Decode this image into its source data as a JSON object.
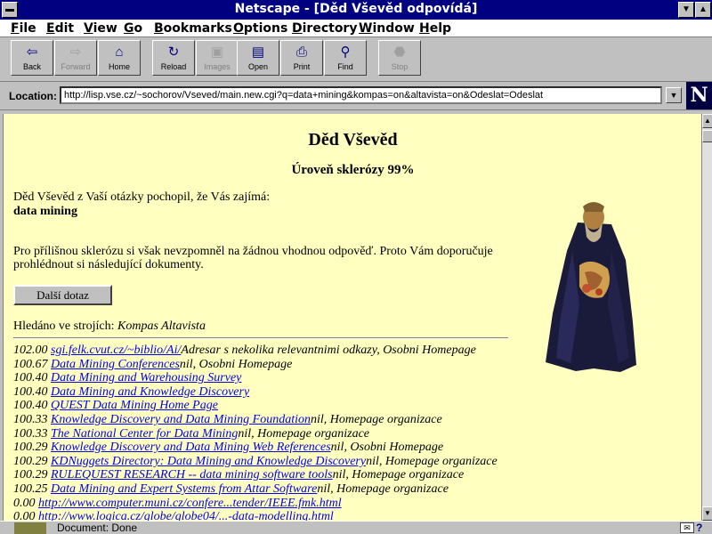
{
  "window": {
    "title": "Netscape - [Děd Vševěd odpovídá]"
  },
  "menu": [
    {
      "label": "File",
      "underline": "F",
      "rest": "ile"
    },
    {
      "label": "Edit",
      "underline": "E",
      "rest": "dit"
    },
    {
      "label": "View",
      "underline": "V",
      "rest": "iew"
    },
    {
      "label": "Go",
      "underline": "G",
      "rest": "o"
    },
    {
      "label": "Bookmarks",
      "underline": "B",
      "rest": "ookmarks"
    },
    {
      "label": "Options",
      "underline": "O",
      "rest": "ptions"
    },
    {
      "label": "Directory",
      "underline": "D",
      "rest": "irectory"
    },
    {
      "label": "Window",
      "underline": "W",
      "rest": "indow"
    },
    {
      "label": "Help",
      "underline": "H",
      "rest": "elp"
    }
  ],
  "toolbar": {
    "back": "Back",
    "forward": "Forward",
    "home": "Home",
    "reload": "Reload",
    "images": "Images",
    "open": "Open",
    "print": "Print",
    "find": "Find",
    "stop": "Stop"
  },
  "location": {
    "label": "Location:",
    "url": "http://lisp.vse.cz/~sochorov/Vseved/main.new.cgi?q=data+mining&kompas=on&altavista=on&Odeslat=Odeslat"
  },
  "page": {
    "title": "Děd Vševěd",
    "subtitle": "Úroveň sklerózy 99%",
    "intro": "Děd Vševěd z Vaší otázky pochopil, že Vás zajímá:",
    "query": "data mining",
    "message1": "Pro přílišnou sklerózu si však nevzpomněl na žádnou vhodnou odpověď. Proto Vám doporučuje",
    "message2": "prohlédnout si následující dokumenty.",
    "button": "Další dotaz",
    "searched_label": "Hledáno ve strojích:",
    "searched_engines": "Kompas Altavista"
  },
  "results": [
    {
      "score": "102.00",
      "link": "sgi.felk.cvut.cz/~biblio/Ai/",
      "desc": "Adresar s nekolika relevantnimi odkazy, Osobni Homepage"
    },
    {
      "score": "100.67",
      "link": "Data Mining Conferences",
      "desc": "nil, Osobni Homepage"
    },
    {
      "score": "100.40",
      "link": "Data Mining and Warehousing Survey",
      "desc": ""
    },
    {
      "score": "100.40",
      "link": "Data Mining and Knowledge Discovery",
      "desc": ""
    },
    {
      "score": "100.40",
      "link": "QUEST Data Mining Home Page",
      "desc": ""
    },
    {
      "score": "100.33",
      "link": "Knowledge Discovery and Data Mining Foundation",
      "desc": "nil, Homepage organizace"
    },
    {
      "score": "100.33",
      "link": "The National Center for Data Mining",
      "desc": "nil, Homepage organizace"
    },
    {
      "score": "100.29",
      "link": "Knowledge Discovery and Data Mining Web References",
      "desc": "nil, Osobni Homepage"
    },
    {
      "score": "100.29",
      "link": "KDNuggets Directory: Data Mining and Knowledge Discovery",
      "desc": "nil, Homepage organizace"
    },
    {
      "score": "100.29",
      "link": "RULEQUEST RESEARCH -- data mining software tools",
      "desc": "nil, Homepage organizace"
    },
    {
      "score": "100.25",
      "link": "Data Mining and Expert Systems from Attar Software",
      "desc": "nil, Homepage organizace"
    },
    {
      "score": "0.00",
      "link": "http://www.computer.muni.cz/confere...tender/IEEE.fmk.html",
      "desc": ""
    },
    {
      "score": "0.00",
      "link": "http://www.logica.cz/globe/globe04/...-data-modelling.html",
      "desc": ""
    }
  ],
  "status": {
    "text": "Document: Done"
  },
  "logo": {
    "letter": "N"
  }
}
